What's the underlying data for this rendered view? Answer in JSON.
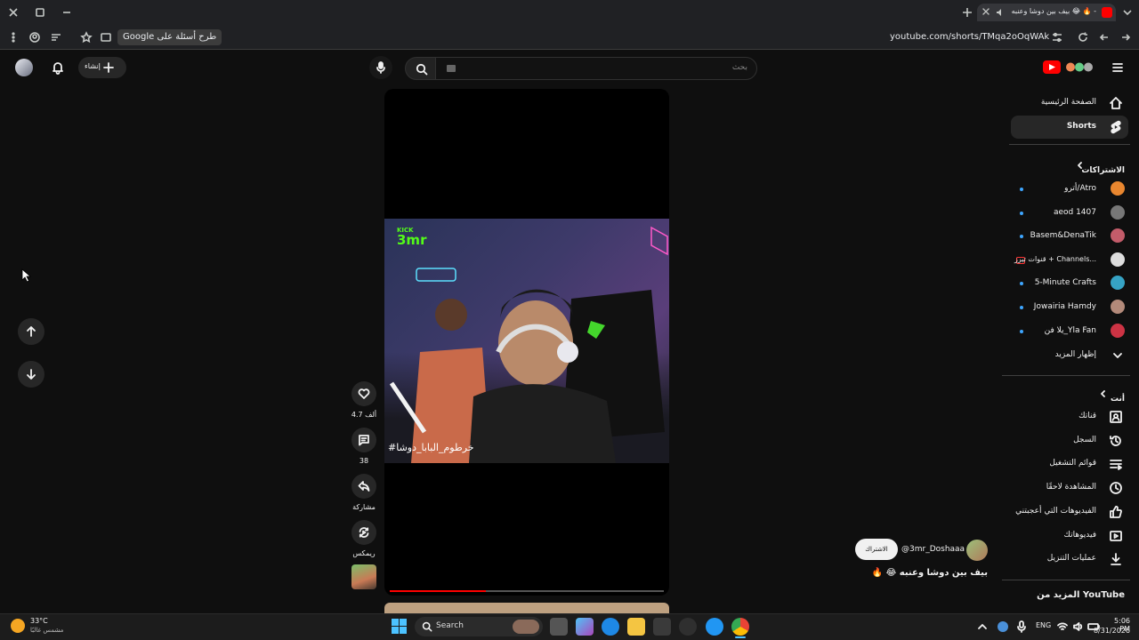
{
  "browser": {
    "tab_title": "بيف بين دوشا وعنبه 😂 🔥 -",
    "url": "youtube.com/shorts/TMqa2oOqWAk",
    "google_chip": "طرح أسئلة على Google"
  },
  "header": {
    "search_placeholder": "بحث",
    "create_label": "إنشاء"
  },
  "sidebar": {
    "home": "الصفحة الرئيسية",
    "shorts": "Shorts",
    "subscriptions_title": "الاشتراكات",
    "subscriptions": [
      {
        "name": "أترو/Atro",
        "color": "#e8862f"
      },
      {
        "name": "aeod 1407",
        "color": "#777777"
      },
      {
        "name": "Basem&DenaTik",
        "color": "#c35c6a"
      },
      {
        "name": "قنوات تيرز + Channels...",
        "color": "#dddddd"
      },
      {
        "name": "5-Minute Crafts",
        "color": "#36a3c4"
      },
      {
        "name": "Jowairia Hamdy",
        "color": "#b38a7a"
      },
      {
        "name": "يلا فن_Yla Fan",
        "color": "#cc3344"
      }
    ],
    "show_more": "إظهار المزيد",
    "you_title": "أنت",
    "you_items": [
      {
        "label": "قناتك",
        "icon": "channel-icon"
      },
      {
        "label": "السجل",
        "icon": "history-icon"
      },
      {
        "label": "قوائم التشغيل",
        "icon": "playlists-icon"
      },
      {
        "label": "المشاهدة لاحقًا",
        "icon": "watch-later-icon"
      },
      {
        "label": "الفيديوهات التي أعجبتني",
        "icon": "thumbs-up-icon"
      },
      {
        "label": "فيديوهاتك",
        "icon": "your-videos-icon"
      },
      {
        "label": "عمليات التنزيل",
        "icon": "download-icon"
      }
    ],
    "more_from_youtube": "المزيد من YouTube"
  },
  "short": {
    "channel": "@3mr_Doshaaa",
    "subscribe": "الاشتراك",
    "title": "بيف بين دوشا وعنبه 😂 🔥",
    "caption": "#خرطوم_البابا_دوشا",
    "kick_top": "KICK",
    "kick_brand": "3mr",
    "progress": 0.35,
    "likes": "4.7 ألف",
    "comments": "38",
    "share": "مشاركة",
    "remix": "ريمكس"
  },
  "taskbar": {
    "temp": "33°C",
    "weather": "مشمس غالبًا",
    "search": "Search",
    "lang": "ENG",
    "time": "5:06 PM",
    "date": "8/31/2026"
  }
}
